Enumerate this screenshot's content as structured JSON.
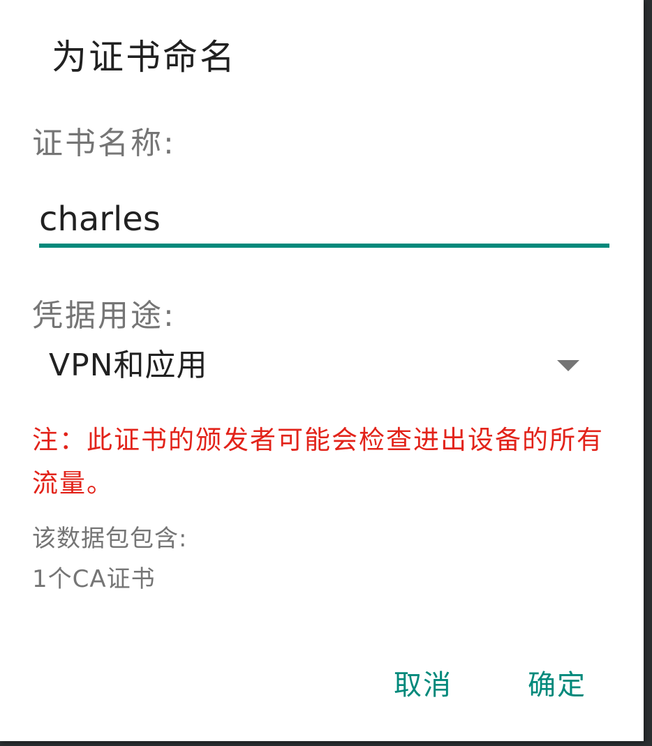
{
  "dialog": {
    "title": "为证书命名",
    "cert_name_label": "证书名称:",
    "cert_name_value": "charles",
    "usage_label": "凭据用途:",
    "usage_selected": "VPN和应用",
    "warning": "注：此证书的颁发者可能会检查进出设备的所有流量。",
    "contains_label": "该数据包包含:",
    "contains_value": "1个CA证书",
    "cancel_label": "取消",
    "ok_label": "确定"
  },
  "colors": {
    "accent": "#00897b",
    "warning": "#e2231a",
    "secondary_text": "#757575",
    "primary_text": "#212121"
  },
  "icons": {
    "spinner_arrow": "dropdown-arrow-icon"
  }
}
